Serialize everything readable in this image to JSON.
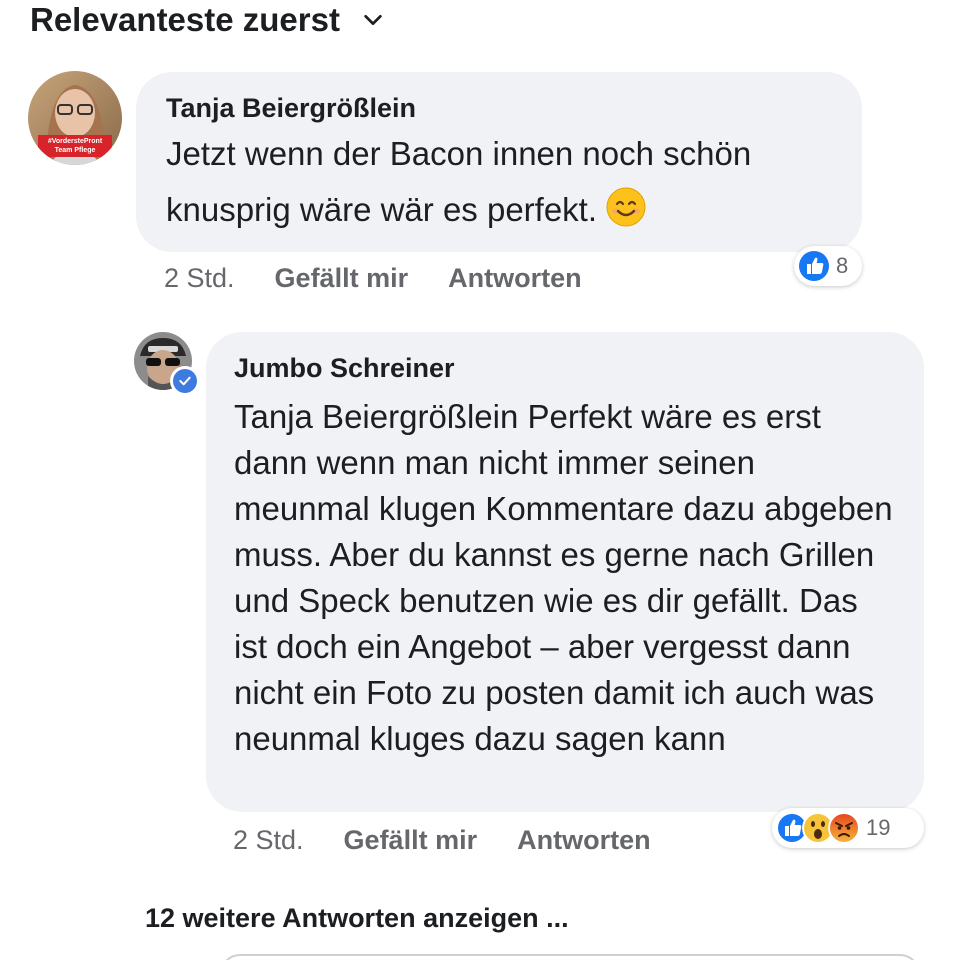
{
  "sort": {
    "label": "Relevanteste zuerst",
    "icon": "chevron-down-icon"
  },
  "comments": [
    {
      "author": "Tanja Beiergrößlein",
      "text": "Jetzt wenn der Bacon innen noch schön knusprig wäre wär es perfekt.",
      "emoji": "smiling-face-emoji",
      "time": "2 Std.",
      "like_label": "Gefällt mir",
      "reply_label": "Antworten",
      "avatar_badge_lines": [
        "#VorderstePront",
        "Team Pflege"
      ],
      "reactions": {
        "icons": [
          "like-reaction-icon"
        ],
        "count": "8"
      }
    },
    {
      "author": "Jumbo Schreiner",
      "verified": true,
      "text": "Tanja Beiergrößlein Perfekt wäre es erst dann wenn man nicht immer seinen meunmal klugen Kommentare dazu abgeben muss. Aber du kannst es gerne nach Grillen und Speck benutzen wie es dir gefällt. Das ist doch ein Angebot – aber vergesst dann nicht ein Foto zu posten damit ich auch was neunmal kluges dazu sagen kann",
      "time": "2 Std.",
      "like_label": "Gefällt mir",
      "reply_label": "Antworten",
      "reactions": {
        "icons": [
          "like-reaction-icon",
          "wow-reaction-icon",
          "angry-reaction-icon"
        ],
        "count": "19"
      }
    }
  ],
  "more_replies_label": "12 weitere Antworten anzeigen ...",
  "colors": {
    "bubble": "#f0f2f5",
    "text": "#1c1e21",
    "meta": "#65676b",
    "like_blue": "#1877f2",
    "verified_blue": "#3d7be0"
  }
}
